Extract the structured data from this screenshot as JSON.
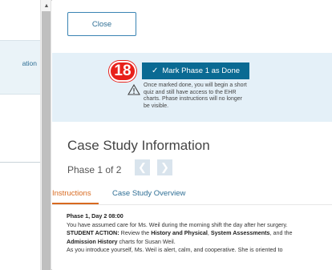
{
  "left_nav": {
    "item_label": "ation"
  },
  "actions": {
    "close_label": "Close",
    "step_number": "18",
    "mark_done_label": "Mark Phase 1 as Done",
    "warning_text": "Once marked done, you will begin a short quiz and still have access to the EHR charts. Phase instructions will no longer be visible."
  },
  "case_study": {
    "title": "Case Study Information",
    "phase_label": "Phase  1 of 2",
    "prev_icon": "chevron-left-icon",
    "next_icon": "chevron-right-icon"
  },
  "tabs": [
    {
      "label": "Instructions",
      "active": true
    },
    {
      "label": "Case Study Overview",
      "active": false
    }
  ],
  "content": {
    "heading": "Phase 1, Day 2 08:00",
    "line1": "You have assumed care for Ms. Weil during the morning shift the day after her surgery.",
    "action_label": "STUDENT ACTION:",
    "action_pre": " Review the ",
    "history_physical": "History and Physical",
    "comma": ", ",
    "system_assessments": "System Assessments",
    "and_the": ", and the",
    "admission_history": "Admission History",
    "charts_for": " charts for Susan Weil.",
    "line_last": "As you introduce yourself, Ms. Weil is alert, calm, and cooperative. She is oriented to"
  },
  "colors": {
    "accent_blue": "#0a6a93",
    "badge_red": "#e8211b",
    "tab_active": "#d86a20",
    "band_bg": "#e4f0f8"
  }
}
